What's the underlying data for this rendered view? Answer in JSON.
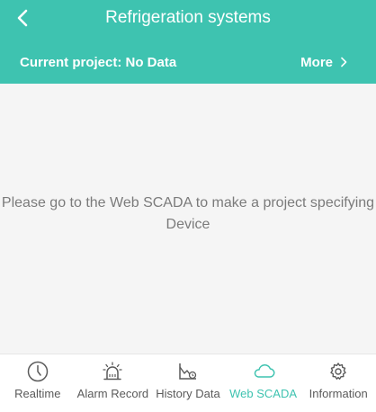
{
  "colors": {
    "accent": "#3ec3b0",
    "inactive_tab": "#5a5a5a",
    "message_text": "#7b7b7b",
    "background": "#f5f5f5"
  },
  "header": {
    "title": "Refrigeration systems",
    "back_icon": "chevron-left-icon",
    "project_label": "Current project:",
    "project_value": "No Data",
    "more_label": "More",
    "more_icon": "chevron-right-icon"
  },
  "content": {
    "message": "Please go to the Web SCADA to make a project specifying Device"
  },
  "tabs": [
    {
      "label": "Realtime",
      "icon": "clock-icon",
      "active": false
    },
    {
      "label": "Alarm Record",
      "icon": "alarm-bell-icon",
      "active": false
    },
    {
      "label": "History Data",
      "icon": "history-chart-icon",
      "active": false
    },
    {
      "label": "Web SCADA",
      "icon": "cloud-icon",
      "active": true
    },
    {
      "label": "Information",
      "icon": "gear-icon",
      "active": false
    }
  ]
}
